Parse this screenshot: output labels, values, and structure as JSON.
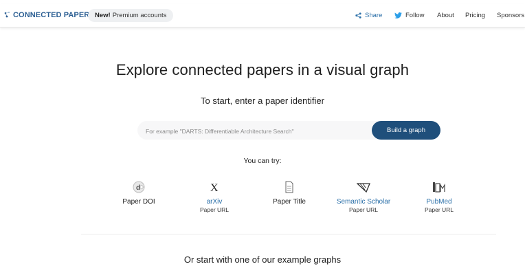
{
  "header": {
    "logo_text": "CONNECTED PAPERS",
    "premium_new": "New!",
    "premium_text": "Premium accounts",
    "nav": {
      "share": "Share",
      "follow": "Follow",
      "about": "About",
      "pricing": "Pricing",
      "sponsors": "Sponsors"
    }
  },
  "main": {
    "title": "Explore connected papers in a visual graph",
    "subtitle": "To start, enter a paper identifier",
    "search": {
      "placeholder": "For example \"DARTS: Differentiable Architecture Search\"",
      "value": ""
    },
    "build_button": "Build a graph",
    "try_label": "You can try:",
    "options": [
      {
        "label": "Paper DOI",
        "sub": "",
        "icon": "doi-icon"
      },
      {
        "label": "arXiv",
        "sub": "Paper URL",
        "icon": "arxiv-icon"
      },
      {
        "label": "Paper Title",
        "sub": "",
        "icon": "document-icon"
      },
      {
        "label": "Semantic Scholar",
        "sub": "Paper URL",
        "icon": "semantic-scholar-icon"
      },
      {
        "label": "PubMed",
        "sub": "Paper URL",
        "icon": "pubmed-icon"
      }
    ],
    "examples_heading": "Or start with one of our example graphs"
  },
  "colors": {
    "brand": "#2c5f93",
    "button": "#1f4f7b",
    "link": "#2a6fa8"
  }
}
